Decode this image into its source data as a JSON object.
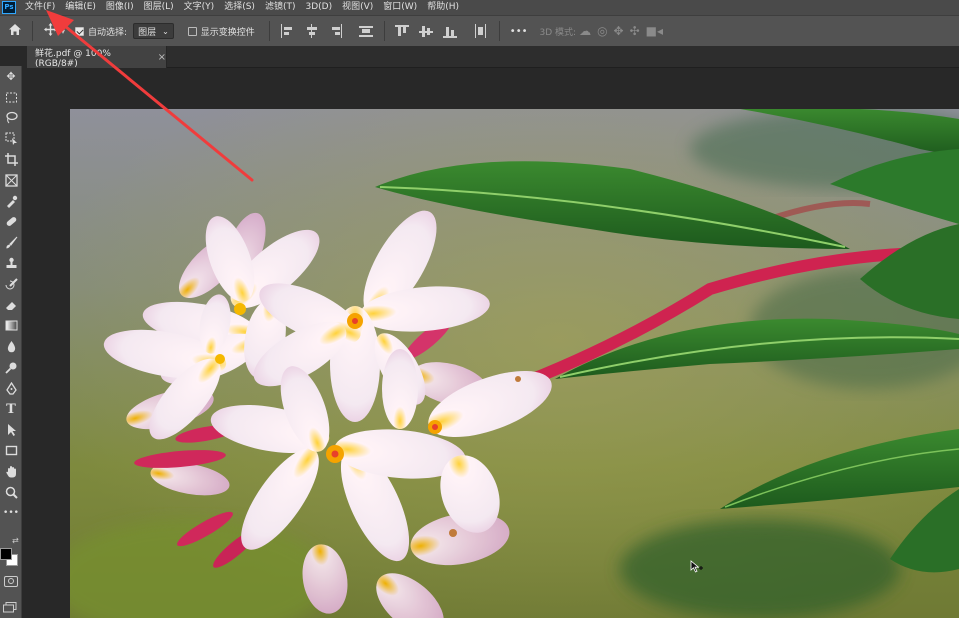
{
  "app": {
    "logo": "Ps"
  },
  "menu": [
    "文件(F)",
    "编辑(E)",
    "图像(I)",
    "图层(L)",
    "文字(Y)",
    "选择(S)",
    "滤镜(T)",
    "3D(D)",
    "视图(V)",
    "窗口(W)",
    "帮助(H)"
  ],
  "options": {
    "auto_select_label": "自动选择:",
    "auto_select_checked": true,
    "auto_select_target": "图层",
    "show_transform_label": "显示变换控件",
    "show_transform_checked": false,
    "more_label": "•••",
    "mode_3d_label": "3D 模式:"
  },
  "document": {
    "tab_title": "鲜花.pdf @ 100%(RGB/8#)",
    "close_label": "×"
  },
  "annotation": {
    "color": "#f03c3c"
  },
  "photo": {
    "subject": "frangipani flowers with green leaves",
    "colors": {
      "bg_top": "#8d8f99",
      "bg_mid": "#7c8a4a",
      "leaf": "#2f7a2a",
      "stem": "#d8254f",
      "petal": "#f5f0f5",
      "center": "#f5b800"
    }
  }
}
